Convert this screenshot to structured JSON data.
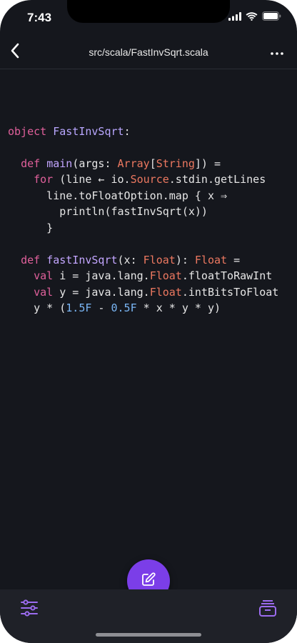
{
  "status": {
    "time": "7:43",
    "signal_icon": "signal-bars-icon",
    "wifi_icon": "wifi-icon",
    "battery_icon": "battery-icon"
  },
  "nav": {
    "back_icon": "chevron-left-icon",
    "title": "src/scala/FastInvSqrt.scala",
    "more_icon": "ellipsis-icon"
  },
  "code": {
    "language": "scala",
    "lines": [
      [],
      [
        {
          "t": "object",
          "c": "kw"
        },
        {
          "t": " ",
          "c": "plain"
        },
        {
          "t": "FastInvSqrt",
          "c": "name"
        },
        {
          "t": ":",
          "c": "plain"
        }
      ],
      [],
      [
        {
          "t": "  ",
          "c": "plain"
        },
        {
          "t": "def",
          "c": "kw"
        },
        {
          "t": " ",
          "c": "plain"
        },
        {
          "t": "main",
          "c": "fn"
        },
        {
          "t": "(args: ",
          "c": "plain"
        },
        {
          "t": "Array",
          "c": "type"
        },
        {
          "t": "[",
          "c": "plain"
        },
        {
          "t": "String",
          "c": "type"
        },
        {
          "t": "]) =",
          "c": "plain"
        }
      ],
      [
        {
          "t": "    ",
          "c": "plain"
        },
        {
          "t": "for",
          "c": "kw"
        },
        {
          "t": " (line ← io.",
          "c": "plain"
        },
        {
          "t": "Source",
          "c": "type"
        },
        {
          "t": ".stdin.getLines",
          "c": "plain"
        }
      ],
      [
        {
          "t": "      line.toFloatOption.map { x ⇒",
          "c": "plain"
        }
      ],
      [
        {
          "t": "        println(fastInvSqrt(x))",
          "c": "plain"
        }
      ],
      [
        {
          "t": "      }",
          "c": "plain"
        }
      ],
      [],
      [
        {
          "t": "  ",
          "c": "plain"
        },
        {
          "t": "def",
          "c": "kw"
        },
        {
          "t": " ",
          "c": "plain"
        },
        {
          "t": "fastInvSqrt",
          "c": "fn"
        },
        {
          "t": "(x: ",
          "c": "plain"
        },
        {
          "t": "Float",
          "c": "type"
        },
        {
          "t": "): ",
          "c": "plain"
        },
        {
          "t": "Float",
          "c": "type"
        },
        {
          "t": " =",
          "c": "plain"
        }
      ],
      [
        {
          "t": "    ",
          "c": "plain"
        },
        {
          "t": "val",
          "c": "kw"
        },
        {
          "t": " i = java.lang.",
          "c": "plain"
        },
        {
          "t": "Float",
          "c": "type"
        },
        {
          "t": ".floatToRawInt",
          "c": "plain"
        }
      ],
      [
        {
          "t": "    ",
          "c": "plain"
        },
        {
          "t": "val",
          "c": "kw"
        },
        {
          "t": " y = java.lang.",
          "c": "plain"
        },
        {
          "t": "Float",
          "c": "type"
        },
        {
          "t": ".intBitsToFloat",
          "c": "plain"
        }
      ],
      [
        {
          "t": "    y * (",
          "c": "plain"
        },
        {
          "t": "1.5F",
          "c": "num"
        },
        {
          "t": " - ",
          "c": "plain"
        },
        {
          "t": "0.5F",
          "c": "num"
        },
        {
          "t": " * x * y * y)",
          "c": "plain"
        }
      ]
    ]
  },
  "bottom": {
    "settings_icon": "sliders-icon",
    "edit_icon": "pencil-square-icon",
    "drawer_icon": "drawer-stack-icon"
  },
  "colors": {
    "background": "#15171d",
    "bottom_bar": "#1f2128",
    "accent": "#7b3ee8",
    "accent_icon": "#9c6cf0",
    "keyword": "#e0609b",
    "type": "#ec7860",
    "function": "#c3a6ff",
    "number": "#7ab6f5"
  }
}
